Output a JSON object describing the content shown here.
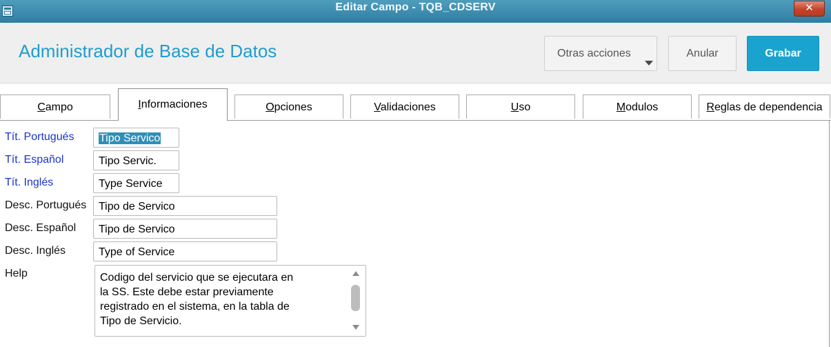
{
  "window": {
    "title": "Editar Campo - TQB_CDSERV",
    "close_label": "✕",
    "app_icon": "window-app-icon"
  },
  "header": {
    "app_title": "Administrador de Base de Datos",
    "buttons": {
      "otras_acciones": "Otras acciones",
      "anular": "Anular",
      "grabar": "Grabar"
    },
    "accent_color": "#1aa3cf"
  },
  "tabs": [
    {
      "first": "C",
      "rest": "ampo",
      "active": false
    },
    {
      "first": "I",
      "rest": "nformaciones",
      "active": true
    },
    {
      "first": "O",
      "rest": "pciones",
      "active": false
    },
    {
      "first": "V",
      "rest": "alidaciones",
      "active": false
    },
    {
      "first": "U",
      "rest": "so",
      "active": false
    },
    {
      "first": "M",
      "rest": "odulos",
      "active": false
    },
    {
      "first": "R",
      "rest": "eglas de dependencia",
      "active": false
    }
  ],
  "form": {
    "tit_portugues": {
      "label": "Tít. Portugués",
      "value": "Tipo Servico"
    },
    "tit_espanol": {
      "label": "Tít. Español",
      "value": "Tipo Servic."
    },
    "tit_ingles": {
      "label": "Tít. Inglés",
      "value": "Type Service"
    },
    "desc_portugues": {
      "label": "Desc. Portugués",
      "value": "Tipo de Servico"
    },
    "desc_espanol": {
      "label": "Desc. Español",
      "value": "Tipo de Servico"
    },
    "desc_ingles": {
      "label": "Desc. Inglés",
      "value": "Type of Service"
    },
    "help": {
      "label": "Help",
      "lines": [
        "Codigo del servicio que se ejecutara en",
        "la SS. Este debe estar previamente",
        "registrado en el sistema, en la tabla de",
        "Tipo de Servicio."
      ]
    }
  }
}
